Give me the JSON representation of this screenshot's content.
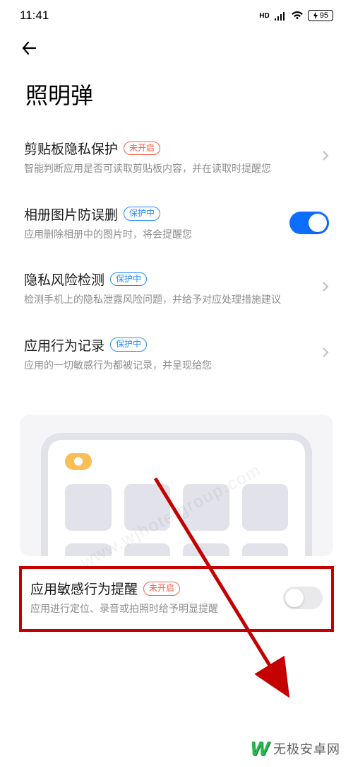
{
  "status": {
    "time": "11:41",
    "hd": "HD",
    "battery": "95"
  },
  "page": {
    "title": "照明弹"
  },
  "settings": [
    {
      "title": "剪贴板隐私保护",
      "badge": "未开启",
      "badge_type": "off",
      "desc": "智能判断应用是否可读取剪贴板内容，并在读取时提醒您",
      "control": "chevron"
    },
    {
      "title": "相册图片防误删",
      "badge": "保护中",
      "badge_type": "on",
      "desc": "应用删除相册中的图片时，将会提醒您",
      "control": "toggle-on"
    },
    {
      "title": "隐私风险检测",
      "badge": "保护中",
      "badge_type": "on",
      "desc": "检测手机上的隐私泄露风险问题，并给予对应处理措施建议",
      "control": "chevron"
    },
    {
      "title": "应用行为记录",
      "badge": "保护中",
      "badge_type": "on",
      "desc": "应用的一切敏感行为都被记录，并呈现给您",
      "control": "chevron"
    }
  ],
  "bottom_setting": {
    "title": "应用敏感行为提醒",
    "badge": "未开启",
    "badge_type": "off",
    "desc": "应用进行定位、录音或拍照时给予明显提醒",
    "control": "toggle-off"
  },
  "watermark": {
    "url": "www.wjhotelgroup.com",
    "brand": "无极安卓网"
  }
}
